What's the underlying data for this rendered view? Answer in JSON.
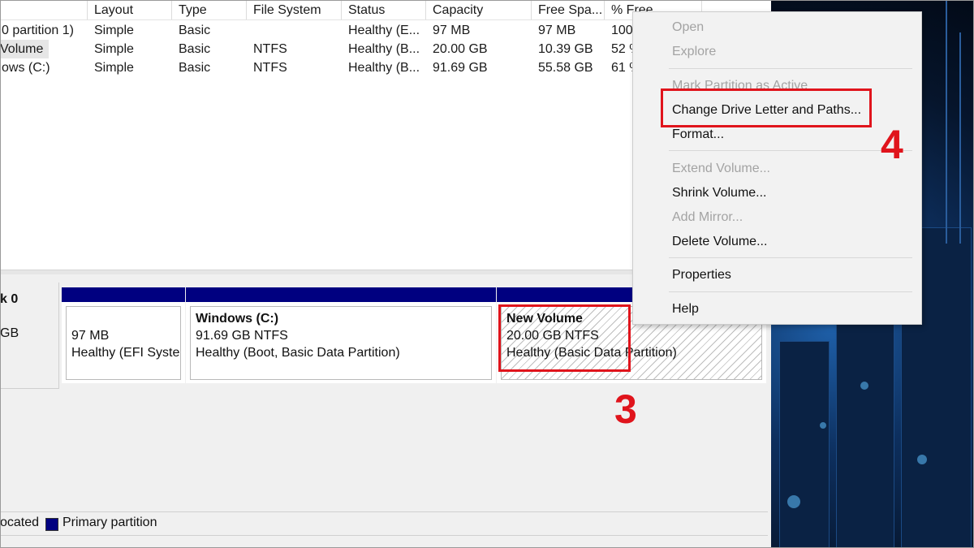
{
  "table": {
    "headers": [
      "Layout",
      "Type",
      "File System",
      "Status",
      "Capacity",
      "Free Spa...",
      "% Free"
    ],
    "rows": [
      {
        "name": "0 partition 1)",
        "layout": "Simple",
        "type": "Basic",
        "fs": "",
        "status": "Healthy (E...",
        "capacity": "97 MB",
        "free": "97 MB",
        "pct": "100"
      },
      {
        "name": "Volume",
        "layout": "Simple",
        "type": "Basic",
        "fs": "NTFS",
        "status": "Healthy (B...",
        "capacity": "20.00 GB",
        "free": "10.39 GB",
        "pct": "52 %"
      },
      {
        "name": "ows (C:)",
        "layout": "Simple",
        "type": "Basic",
        "fs": "NTFS",
        "status": "Healthy (B...",
        "capacity": "91.69 GB",
        "free": "55.58 GB",
        "pct": "61 %"
      }
    ]
  },
  "disk": {
    "label": "k 0",
    "size": "GB",
    "partitions": [
      {
        "title": "",
        "size": "97 MB",
        "status": "Healthy (EFI Syster"
      },
      {
        "title": "Windows  (C:)",
        "size": "91.69 GB NTFS",
        "status": "Healthy (Boot, Basic Data Partition)"
      },
      {
        "title": "New Volume",
        "size": "20.00 GB NTFS",
        "status": "Healthy (Basic Data Partition)"
      }
    ]
  },
  "legend": {
    "unallocated": "ocated",
    "primary": "Primary partition",
    "primary_color": "#000080"
  },
  "context_menu": {
    "items": [
      {
        "label": "Open",
        "enabled": false
      },
      {
        "label": "Explore",
        "enabled": false
      },
      {
        "label": "Mark Partition as Active",
        "enabled": false
      },
      {
        "label": "Change Drive Letter and Paths...",
        "enabled": true
      },
      {
        "label": "Format...",
        "enabled": true
      },
      {
        "label": "Extend Volume...",
        "enabled": false
      },
      {
        "label": "Shrink Volume...",
        "enabled": true
      },
      {
        "label": "Add Mirror...",
        "enabled": false
      },
      {
        "label": "Delete Volume...",
        "enabled": true
      },
      {
        "label": "Properties",
        "enabled": true
      },
      {
        "label": "Help",
        "enabled": true
      }
    ]
  },
  "annotations": {
    "step3": "3",
    "step4": "4",
    "color": "#e0141c"
  }
}
